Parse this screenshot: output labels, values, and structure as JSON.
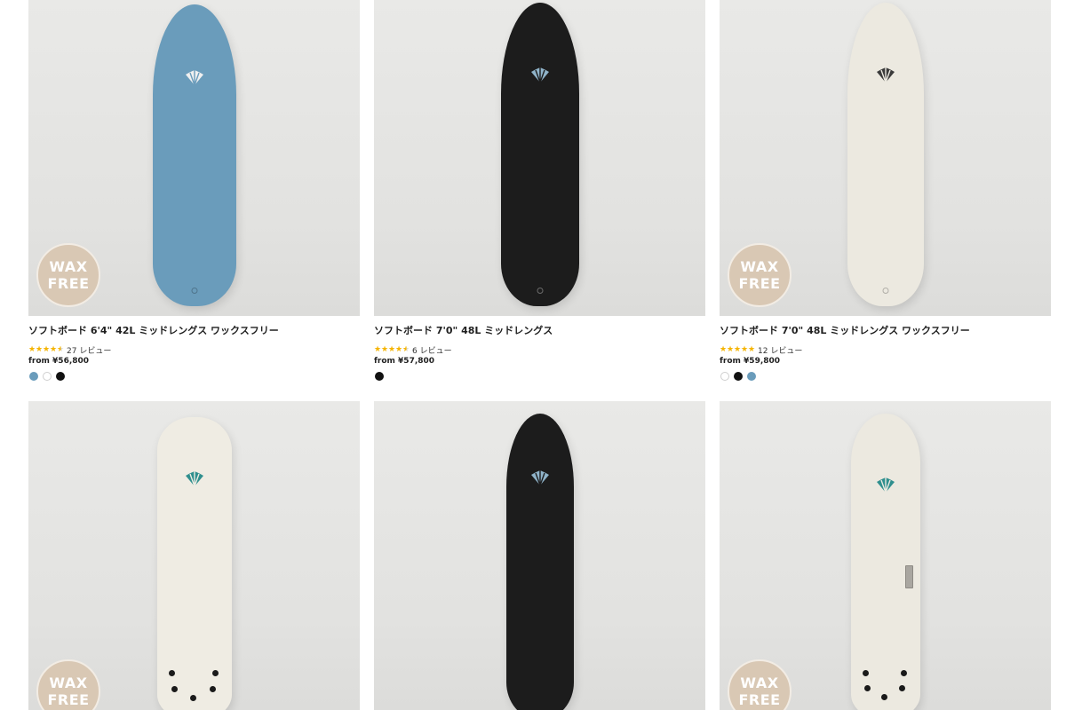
{
  "products": [
    {
      "title": "ソフトボード 6'4\" 42L ミッドレングス ワックスフリー",
      "rating": 4.5,
      "review_count": "27 レビュー",
      "price": "from ¥56,800",
      "badge": [
        "WAX",
        "FREE"
      ],
      "board_color": "#6a9cbb",
      "logo_color": "#f0f0f0",
      "swatches": [
        "#6a9cbb",
        "#ffffff",
        "#111111"
      ]
    },
    {
      "title": "ソフトボード 7'0\" 48L ミッドレングス",
      "rating": 4.5,
      "review_count": "6 レビュー",
      "price": "from ¥57,800",
      "badge": null,
      "board_color": "#1c1c1c",
      "logo_color": "#8fb3c9",
      "swatches": [
        "#111111"
      ]
    },
    {
      "title": "ソフトボード 7'0\" 48L ミッドレングス ワックスフリー",
      "rating": 5,
      "review_count": "12 レビュー",
      "price": "from ¥59,800",
      "badge": [
        "WAX",
        "FREE"
      ],
      "board_color": "#ece9e0",
      "logo_color": "#3a3a3a",
      "swatches": [
        "#ffffff",
        "#111111",
        "#6a9cbb"
      ]
    },
    {
      "badge": [
        "WAX",
        "FREE"
      ],
      "board_color": "#efece3",
      "logo_color": "#2f8f8e"
    },
    {
      "badge": null,
      "board_color": "#1c1c1c",
      "logo_color": "#8fb3c9"
    },
    {
      "badge": [
        "WAX",
        "FREE"
      ],
      "board_color": "#ece9e0",
      "logo_color": "#2f8f8e"
    }
  ]
}
